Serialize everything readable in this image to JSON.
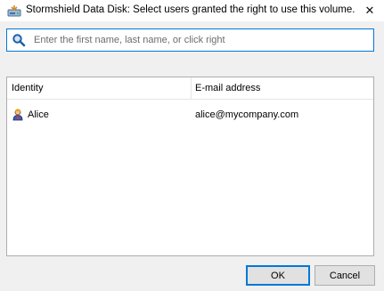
{
  "window": {
    "title": "Stormshield Data Disk: Select users granted the right to use this volume.",
    "close_glyph": "✕",
    "title_icon": "disk-icon"
  },
  "search": {
    "placeholder": "Enter the first name, last name, or click right",
    "value": "",
    "icon": "search-icon"
  },
  "list": {
    "columns": [
      "Identity",
      "E-mail address"
    ],
    "rows": [
      {
        "identity": "Alice",
        "email": "alice@mycompany.com",
        "icon": "user-icon"
      }
    ]
  },
  "buttons": {
    "ok": "OK",
    "cancel": "Cancel"
  },
  "colors": {
    "accent": "#0078d7",
    "window_bg": "#f0f0f0",
    "button_bg": "#e1e1e1"
  }
}
